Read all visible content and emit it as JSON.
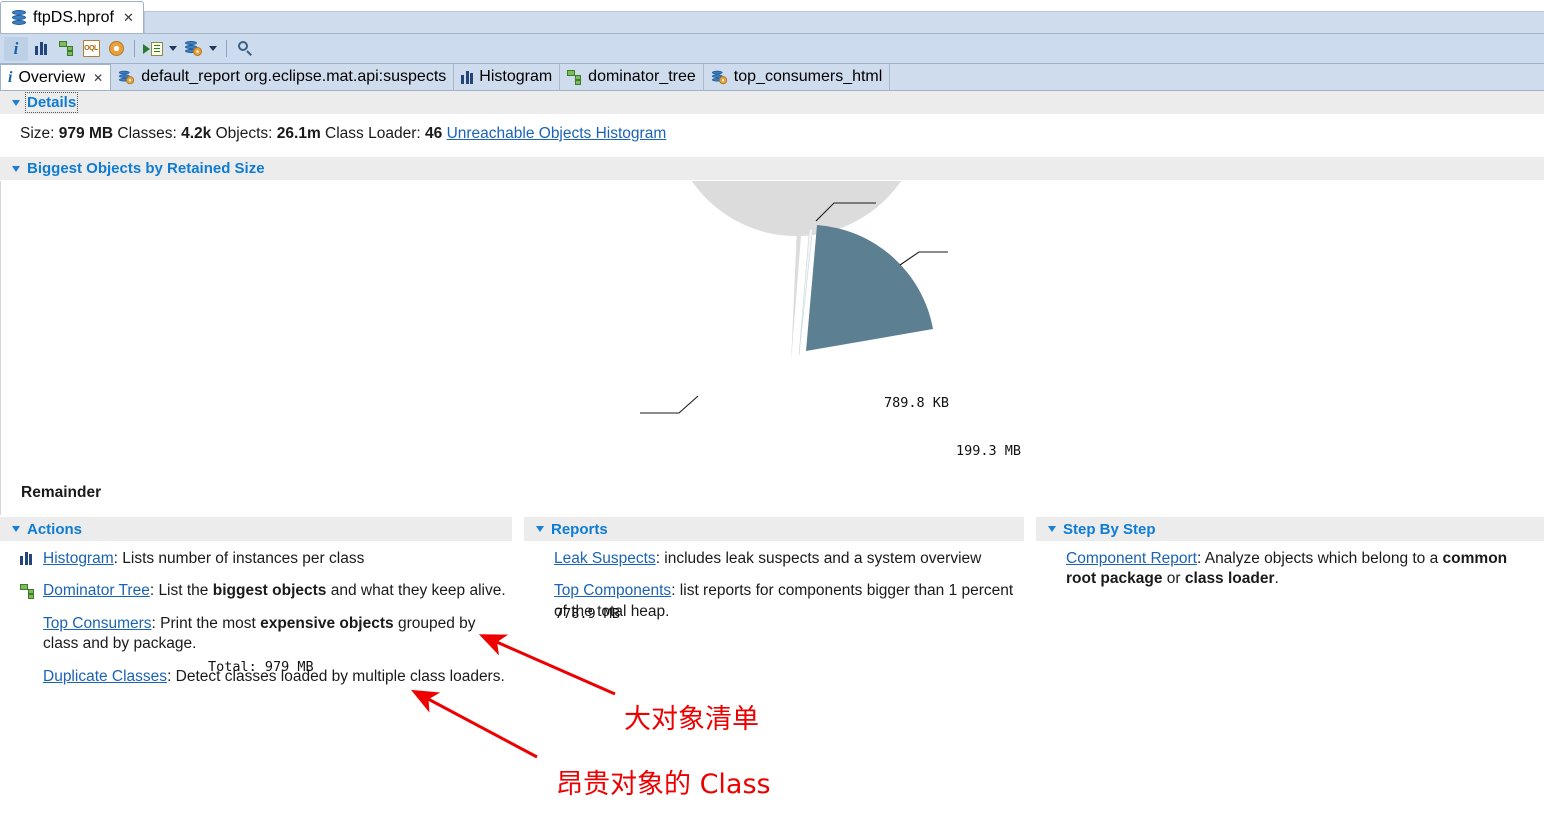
{
  "window": {
    "tab_label": "ftpDS.hprof",
    "tab_close": "✕",
    "icon": "heap-dump-icon"
  },
  "toolbar": {
    "buttons": [
      {
        "name": "overview-info-icon",
        "label": "i"
      },
      {
        "name": "histogram-icon",
        "label": ""
      },
      {
        "name": "dominator-tree-icon",
        "label": ""
      },
      {
        "name": "oql-icon",
        "label": "OQL"
      },
      {
        "name": "inspector-gear-icon",
        "label": ""
      },
      {
        "name": "run-expert-system-test-icon",
        "label": ""
      },
      {
        "name": "open-query-browser-icon",
        "label": ""
      },
      {
        "name": "search-icon",
        "label": ""
      }
    ]
  },
  "folder_tabs": [
    {
      "label": "Overview",
      "icon": "info-icon",
      "selected": true,
      "closable": true
    },
    {
      "label": "default_report org.eclipse.mat.api:suspects",
      "icon": "report-icon",
      "selected": false,
      "closable": false
    },
    {
      "label": "Histogram",
      "icon": "histogram-icon",
      "selected": false,
      "closable": false
    },
    {
      "label": "dominator_tree",
      "icon": "tree-icon",
      "selected": false,
      "closable": false
    },
    {
      "label": "top_consumers_html",
      "icon": "report-icon",
      "selected": false,
      "closable": false
    }
  ],
  "details": {
    "section_title": "Details",
    "size_label": "Size:",
    "size_value": "979 MB",
    "classes_label": "Classes:",
    "classes_value": "4.2k",
    "objects_label": "Objects:",
    "objects_value": "26.1m",
    "classloader_label": "Class Loader:",
    "classloader_value": "46",
    "unreachable_link": "Unreachable Objects Histogram"
  },
  "biggest": {
    "section_title": "Biggest Objects by Retained Size",
    "total_label": "Total:  979 MB",
    "remainder_label": "Remainder"
  },
  "chart_data": {
    "type": "pie",
    "title": "Biggest Objects by Retained Size",
    "labels": [
      "199.3 MB",
      "789.8 KB",
      "778.9 MB"
    ],
    "values": [
      199.3,
      0.7898,
      778.9
    ],
    "units": "MB",
    "total": "979 MB",
    "colors": [
      "#5d7f92",
      "#f2f6f7",
      "#dcdcdc"
    ],
    "legend": "none",
    "annotations": [
      "Total:  979 MB",
      "Remainder"
    ]
  },
  "actions": {
    "section_title": "Actions",
    "items": [
      {
        "icon": "histogram-icon",
        "link": "Histogram",
        "text": ": Lists number of instances per class",
        "bold_parts": []
      },
      {
        "icon": "tree-icon",
        "link": "Dominator Tree",
        "text": ": List the biggest objects and what they keep alive.",
        "bold_parts": [
          "biggest objects"
        ]
      },
      {
        "icon": "none",
        "link": "Top Consumers",
        "text": ": Print the most expensive objects grouped by class and by package.",
        "bold_parts": [
          "expensive objects"
        ]
      },
      {
        "icon": "none",
        "link": "Duplicate Classes",
        "text": ": Detect classes loaded by multiple class loaders.",
        "bold_parts": []
      }
    ]
  },
  "reports": {
    "section_title": "Reports",
    "items": [
      {
        "link": "Leak Suspects",
        "text": ": includes leak suspects and a system overview"
      },
      {
        "link": "Top Components",
        "text": ": list reports for components bigger than 1 percent of the total heap."
      }
    ]
  },
  "stepbystep": {
    "section_title": "Step By Step",
    "items": [
      {
        "link": "Component Report",
        "text": ": Analyze objects which belong to a common root package or class loader.",
        "bold_parts": [
          "common root package",
          "class loader"
        ]
      }
    ]
  },
  "annotations": {
    "color": "#ee0000",
    "notes": [
      {
        "text": "大对象清单",
        "points_to": "Dominator Tree"
      },
      {
        "text": "昂贵对象的  Class",
        "points_to": "Top Consumers"
      }
    ]
  },
  "colors": {
    "accent_link": "#1b63b5",
    "section_title": "#0f7cd4",
    "toolbar_bg": "#ccdcee",
    "tabfolder_bg": "#cfdced",
    "section_bar_bg": "#ececec",
    "pie_blue": "#5d7f92",
    "pie_gray": "#dcdcdc",
    "annotation_red": "#ee0000"
  }
}
